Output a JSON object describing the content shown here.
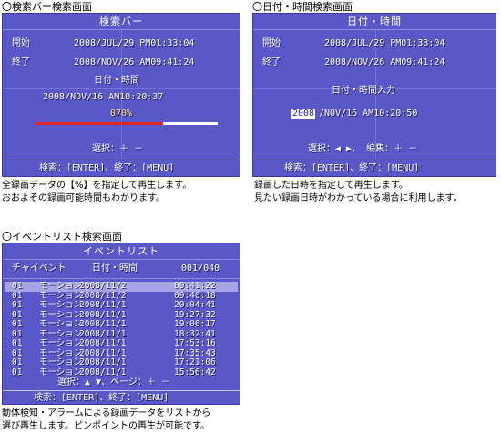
{
  "panel1": {
    "section_title": "〇検索バー検索画面",
    "screen_title": "検索バー",
    "start_label": "開始",
    "start_value": "2008/JUL/29 PM01:33:04",
    "end_label": "終了",
    "end_value": "2008/NOV/26 AM09:41:24",
    "datetime_label": "日付・時間",
    "datetime_value": "2008/NOV/16 AM10:20:37",
    "percent_label": "070%",
    "progress": 0.7,
    "footer_select": "選択：＋ －",
    "footer_keys": "検索：[ENTER]、終了：[MENU]",
    "caption_1": "全録画データの【%】を指定して再生します。",
    "caption_2": "おおよその録画可能時間もわかります。"
  },
  "panel2": {
    "section_title": "〇日付・時間検索画面",
    "screen_title": "日付・時間",
    "start_label": "開始",
    "start_value": "2008/JUL/29 PM01:33:04",
    "end_label": "終了",
    "end_value": "2008/NOV/26 AM09:41:24",
    "input_label": "日付・時間入力",
    "input_year": "2008",
    "input_rest": "/NOV/16 AM10:20:50",
    "footer_select": "選択：◀ ▶、 編集：＋ －",
    "footer_keys": "検索：[ENTER]、終了：[MENU]",
    "caption_1": "録画した日時を指定して再生します。",
    "caption_2": "見たい録画日時がわかっている場合に利用します。"
  },
  "panel3": {
    "section_title": "〇イベントリスト検索画面",
    "screen_title": "イベントリスト",
    "col_ch": "チャイベント",
    "col_datetime": "日付・時間",
    "page_counter": "001/040",
    "rows": [
      {
        "ch": "01",
        "event": "モーション",
        "date": "2008/11/2",
        "time": "09:41:22"
      },
      {
        "ch": "01",
        "event": "モーション",
        "date": "2008/11/2",
        "time": "09:40:18"
      },
      {
        "ch": "01",
        "event": "モーション",
        "date": "2008/11/1",
        "time": "20:04:41"
      },
      {
        "ch": "01",
        "event": "モーション",
        "date": "2008/11/1",
        "time": "19:27:32"
      },
      {
        "ch": "01",
        "event": "モーション",
        "date": "2008/11/1",
        "time": "19:06:17"
      },
      {
        "ch": "01",
        "event": "モーション",
        "date": "2008/11/1",
        "time": "18:32:41"
      },
      {
        "ch": "01",
        "event": "モーション",
        "date": "2008/11/1",
        "time": "17:53:16"
      },
      {
        "ch": "01",
        "event": "モーション",
        "date": "2008/11/1",
        "time": "17:35:43"
      },
      {
        "ch": "01",
        "event": "モーション",
        "date": "2008/11/1",
        "time": "17:21:06"
      },
      {
        "ch": "01",
        "event": "モーション",
        "date": "2008/11/1",
        "time": "15:56:42"
      }
    ],
    "footer_select": "選択：▲ ▼、ページ：＋ －",
    "footer_keys": "検索：[ENTER]、終了：[MENU]",
    "caption_1": "動体検知・アラームによる録画データをリストから",
    "caption_2": "選び再生します。ピンポイントの再生が可能です。"
  },
  "colors": {
    "screen_bg": "#5a58c8",
    "progress_fill": "#e02828",
    "progress_track": "#ffffff",
    "selected_row": "#a6a4e4"
  }
}
